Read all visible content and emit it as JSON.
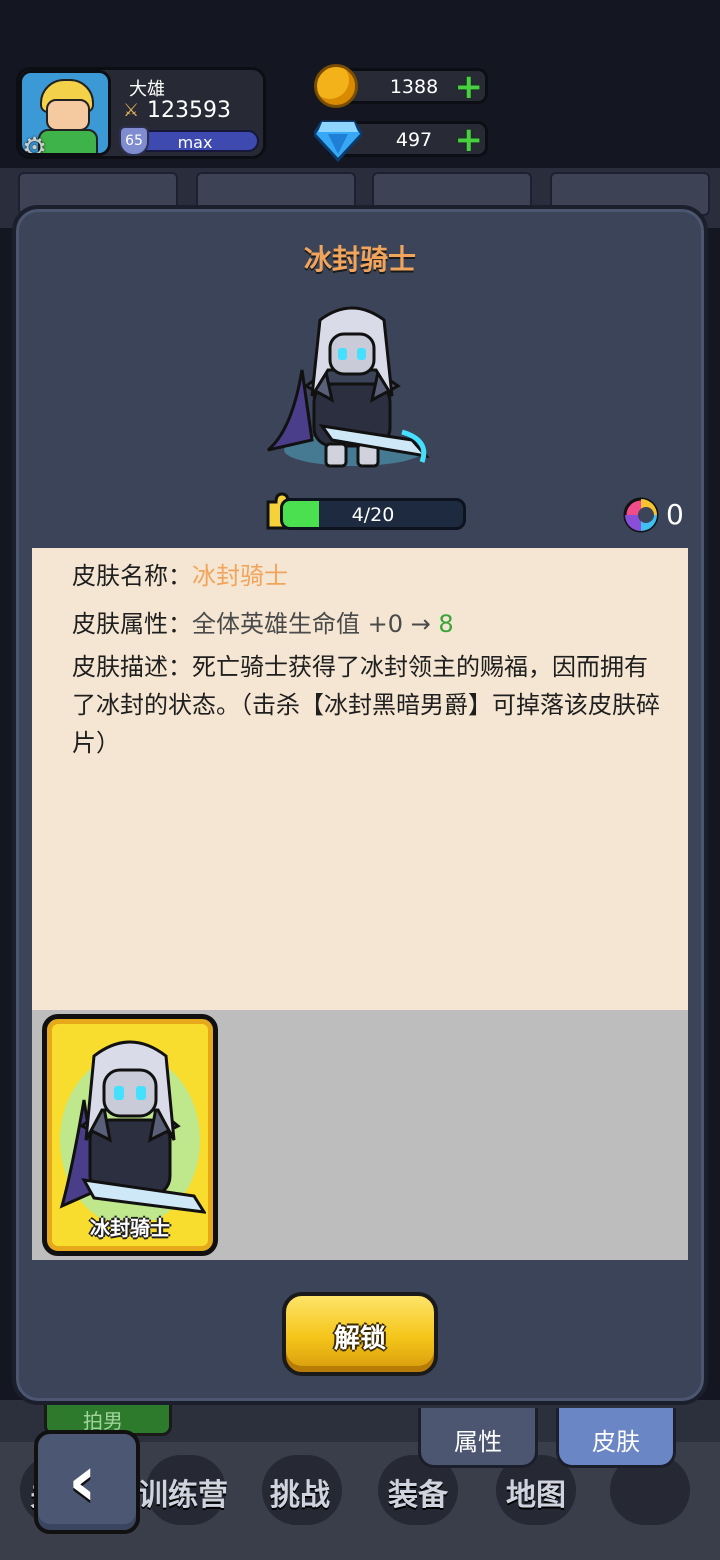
{
  "player": {
    "name": "大雄",
    "power": "123593",
    "level": "65",
    "exp_label": "max"
  },
  "resources": {
    "gold": "1388",
    "diamond": "497"
  },
  "skin": {
    "title": "冰封骑士",
    "fragments": "4/20",
    "fragment_progress": 0.2,
    "candy_count": "0",
    "name_label": "皮肤名称：",
    "name_value": "冰封骑士",
    "attr_label": "皮肤属性：",
    "attr_text": "全体英雄生命值 +0 → ",
    "attr_value": "8",
    "desc_label": "皮肤描述：",
    "desc_text": "死亡骑士获得了冰封领主的赐福，因而拥有了冰封的状态。（击杀【冰封黑暗男爵】可掉落该皮肤碎片）",
    "card_label": "冰封骑士"
  },
  "buttons": {
    "unlock": "解锁"
  },
  "tabs": [
    {
      "label": "属性"
    },
    {
      "label": "皮肤"
    }
  ],
  "background": {
    "tag": "拍男",
    "nav": [
      "关闭",
      "训练营",
      "挑战",
      "装备",
      "地图"
    ]
  },
  "colors": {
    "panel": "#3b4458",
    "title": "#f0a45c",
    "info_bg": "#f4e6d2",
    "unlock_button": "#f4c519",
    "active_tab": "#6a86c4"
  }
}
